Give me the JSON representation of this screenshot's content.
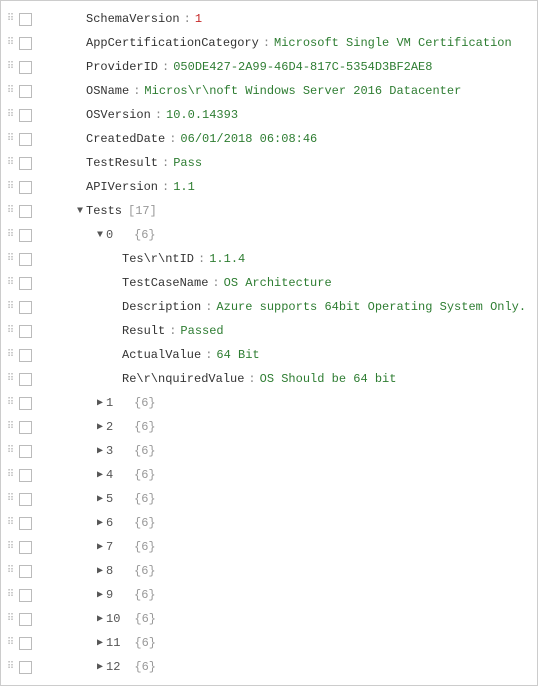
{
  "root": [
    {
      "key": "SchemaVersion",
      "value": "1",
      "valClass": "num",
      "indent": 48,
      "leaf": true
    },
    {
      "key": "AppCertificationCategory",
      "value": "Microsoft Single VM Certification",
      "valClass": "str",
      "indent": 48,
      "leaf": true
    },
    {
      "key": "ProviderID",
      "value": "050DE427-2A99-46D4-817C-5354D3BF2AE8",
      "valClass": "str",
      "indent": 48,
      "leaf": true
    },
    {
      "key": "OSName",
      "value": "Micros\\r\\noft Windows Server 2016 Datacenter",
      "valClass": "str",
      "indent": 48,
      "leaf": true
    },
    {
      "key": "OSVersion",
      "value": "10.0.14393",
      "valClass": "str",
      "indent": 48,
      "leaf": true
    },
    {
      "key": "CreatedDate",
      "value": "06/01/2018 06:08:46",
      "valClass": "str",
      "indent": 48,
      "leaf": true
    },
    {
      "key": "TestResult",
      "value": "Pass",
      "valClass": "str",
      "indent": 48,
      "leaf": true
    },
    {
      "key": "APIVersion",
      "value": "1.1",
      "valClass": "str",
      "indent": 48,
      "leaf": true
    }
  ],
  "testsArray": {
    "key": "Tests",
    "meta": "[17]",
    "indent": 36,
    "state": "open"
  },
  "test0": {
    "index": "0",
    "meta": "{6}",
    "indent": 56,
    "state": "open"
  },
  "test0props": [
    {
      "key": "Tes\\r\\ntID",
      "value": "1.1.4",
      "valClass": "str",
      "indent": 84,
      "leaf": true
    },
    {
      "key": "TestCaseName",
      "value": "OS Architecture",
      "valClass": "str",
      "indent": 84,
      "leaf": true
    },
    {
      "key": "Description",
      "value": "Azure supports 64bit Operating System Only.",
      "valClass": "str",
      "indent": 84,
      "leaf": true
    },
    {
      "key": "Result",
      "value": "Passed",
      "valClass": "str",
      "indent": 84,
      "leaf": true
    },
    {
      "key": "ActualValue",
      "value": "64 Bit",
      "valClass": "str",
      "indent": 84,
      "leaf": true
    },
    {
      "key": "Re\\r\\nquiredValue",
      "value": "OS Should be 64 bit",
      "valClass": "str",
      "indent": 84,
      "leaf": true
    }
  ],
  "collapsedTests": [
    {
      "index": "1",
      "meta": "{6}",
      "indent": 56
    },
    {
      "index": "2",
      "meta": "{6}",
      "indent": 56
    },
    {
      "index": "3",
      "meta": "{6}",
      "indent": 56
    },
    {
      "index": "4",
      "meta": "{6}",
      "indent": 56
    },
    {
      "index": "5",
      "meta": "{6}",
      "indent": 56
    },
    {
      "index": "6",
      "meta": "{6}",
      "indent": 56
    },
    {
      "index": "7",
      "meta": "{6}",
      "indent": 56
    },
    {
      "index": "8",
      "meta": "{6}",
      "indent": 56
    },
    {
      "index": "9",
      "meta": "{6}",
      "indent": 56
    },
    {
      "index": "10",
      "meta": "{6}",
      "indent": 56
    },
    {
      "index": "11",
      "meta": "{6}",
      "indent": 56
    },
    {
      "index": "12",
      "meta": "{6}",
      "indent": 56
    }
  ]
}
